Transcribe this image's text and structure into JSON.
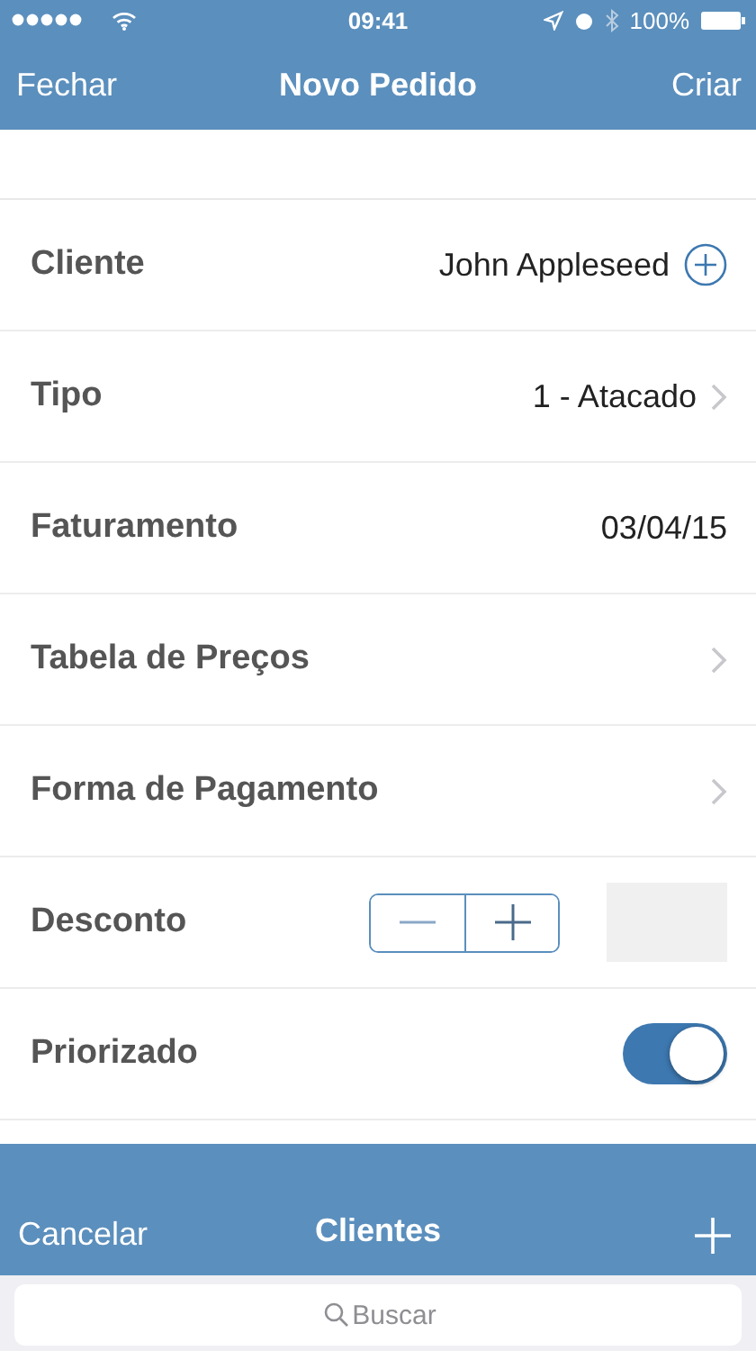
{
  "status_bar": {
    "time": "09:41",
    "battery": "100%"
  },
  "nav": {
    "left": "Fechar",
    "title": "Novo Pedido",
    "right": "Criar"
  },
  "rows": [
    {
      "kind": "add",
      "label": "Cliente",
      "value": "John  Appleseed"
    },
    {
      "kind": "select",
      "label": "Tipo",
      "value": "1 - Atacado"
    },
    {
      "kind": "text",
      "label": "Faturamento",
      "value": "03/04/15"
    },
    {
      "kind": "select",
      "label": "Tabela de Preços"
    },
    {
      "kind": "select",
      "label": "Forma de Pagamento"
    },
    {
      "kind": "stepper",
      "label": "Desconto"
    },
    {
      "kind": "switch",
      "label": "Priorizado",
      "on": true
    }
  ],
  "sheet": {
    "left": "Cancelar",
    "title": "Clientes",
    "search": {
      "placeholder": "Buscar"
    }
  }
}
